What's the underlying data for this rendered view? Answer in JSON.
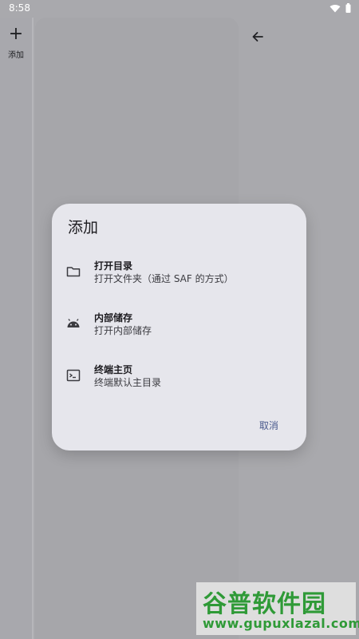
{
  "status_bar": {
    "time": "8:58"
  },
  "rail": {
    "add_label": "添加"
  },
  "dialog": {
    "title": "添加",
    "items": [
      {
        "title": "打开目录",
        "subtitle": "打开文件夹（通过 SAF 的方式）",
        "icon": "folder-icon"
      },
      {
        "title": "内部储存",
        "subtitle": "打开内部储存",
        "icon": "android-icon"
      },
      {
        "title": "终端主页",
        "subtitle": "终端默认主目录",
        "icon": "terminal-icon"
      }
    ],
    "cancel_label": "取消"
  },
  "watermark": {
    "name": "谷普软件园",
    "url": "www.gupuxlazal.com"
  },
  "colors": {
    "accent": "#4a5a8d",
    "dialog_bg": "#e6e6ec",
    "scrim": "#a9a9ad",
    "watermark": "#2f9a37"
  }
}
